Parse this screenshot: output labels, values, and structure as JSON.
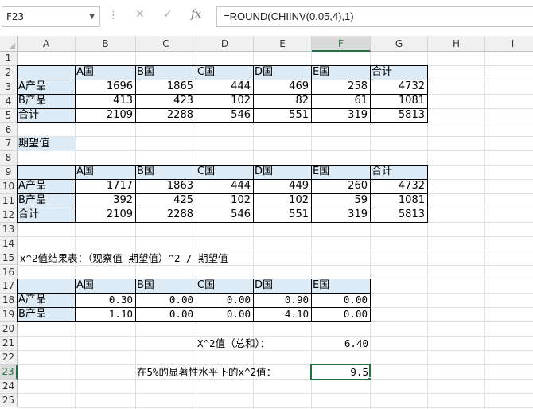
{
  "formula_bar": {
    "name_box": "F23",
    "fx": "fx",
    "cancel": "✕",
    "confirm": "✓",
    "formula": "=ROUND(CHIINV(0.05,4),1)"
  },
  "columns": [
    "A",
    "B",
    "C",
    "D",
    "E",
    "F",
    "G",
    "H",
    "I"
  ],
  "rows": [
    "1",
    "2",
    "3",
    "4",
    "5",
    "6",
    "7",
    "8",
    "9",
    "10",
    "11",
    "12",
    "13",
    "14",
    "15",
    "16",
    "17",
    "18",
    "19",
    "20",
    "21",
    "22",
    "23",
    "24",
    "25"
  ],
  "observed": {
    "headers": [
      "",
      "A国",
      "B国",
      "C国",
      "D国",
      "E国",
      "合计"
    ],
    "rows": [
      [
        "A产品",
        "1696",
        "1865",
        "444",
        "469",
        "258",
        "4732"
      ],
      [
        "B产品",
        "413",
        "423",
        "102",
        "82",
        "61",
        "1081"
      ],
      [
        "合计",
        "2109",
        "2288",
        "546",
        "551",
        "319",
        "5813"
      ]
    ]
  },
  "expected_label": "期望值",
  "expected": {
    "headers": [
      "",
      "A国",
      "B国",
      "C国",
      "D国",
      "E国",
      "合计"
    ],
    "rows": [
      [
        "A产品",
        "1717",
        "1863",
        "444",
        "449",
        "260",
        "4732"
      ],
      [
        "B产品",
        "392",
        "425",
        "102",
        "102",
        "59",
        "1081"
      ],
      [
        "合计",
        "2109",
        "2288",
        "546",
        "551",
        "319",
        "5813"
      ]
    ]
  },
  "chi_title": "x^2值结果表：（观察值-期望值）^2 / 期望值",
  "chi": {
    "headers": [
      "",
      "A国",
      "B国",
      "C国",
      "D国",
      "E国"
    ],
    "rows": [
      [
        "A产品",
        "0.30",
        "0.00",
        "0.00",
        "0.90",
        "0.00"
      ],
      [
        "B产品",
        "1.10",
        "0.00",
        "0.00",
        "4.10",
        "0.00"
      ]
    ]
  },
  "chi_sum_label": "X^2值（总和）：",
  "chi_sum_value": "6.40",
  "critical_label": "在5%的显著性水平下的x^2值：",
  "critical_value": "9.5"
}
